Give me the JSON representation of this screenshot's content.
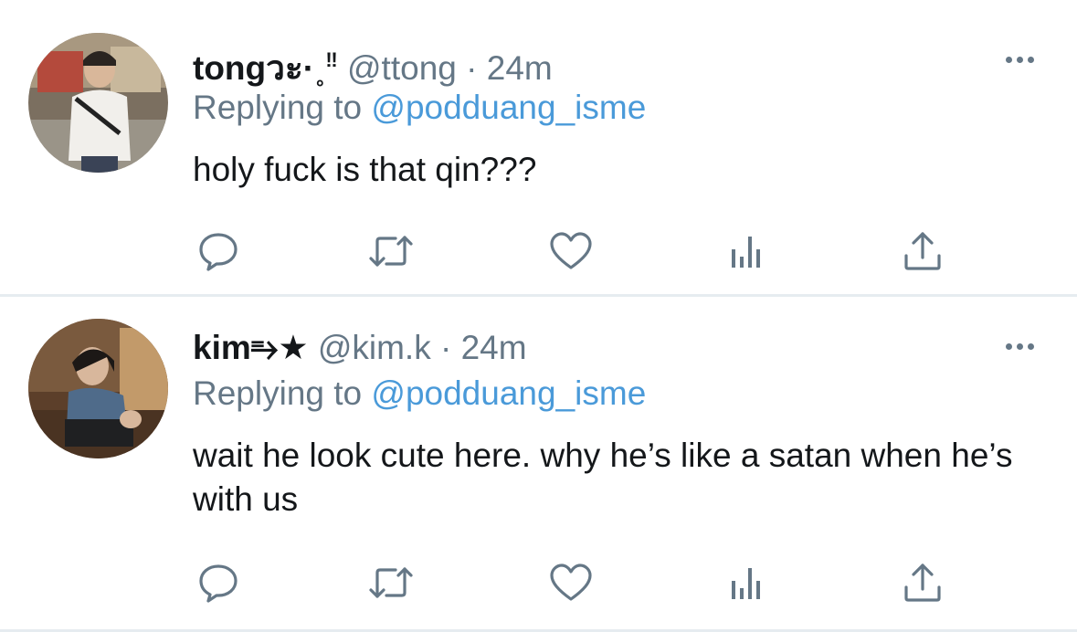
{
  "tweets": [
    {
      "display_name": "tongวะ·˳",
      "display_name_extra": "‼",
      "handle": "@ttong",
      "separator": "·",
      "time": "24m",
      "replying_label": "Replying to",
      "replying_to": "@podduang_isme",
      "text": "holy fuck is that qin???",
      "avatar_icon": "profile-photo-man-white-shirt",
      "actions": [
        "reply-icon",
        "retweet-icon",
        "like-icon",
        "analytics-icon",
        "share-icon"
      ]
    },
    {
      "display_name": "kim⥱★",
      "display_name_extra": "",
      "handle": "@kim.k",
      "separator": "·",
      "time": "24m",
      "replying_label": "Replying to",
      "replying_to": "@podduang_isme",
      "text": "wait he look cute here. why he’s like a satan when he’s with us",
      "avatar_icon": "profile-photo-man-sitting",
      "actions": [
        "reply-icon",
        "retweet-icon",
        "like-icon",
        "analytics-icon",
        "share-icon"
      ]
    }
  ],
  "colors": {
    "text": "#14171a",
    "secondary": "#657786",
    "mention": "#4a9ad9",
    "divider": "#e6ecf0"
  }
}
